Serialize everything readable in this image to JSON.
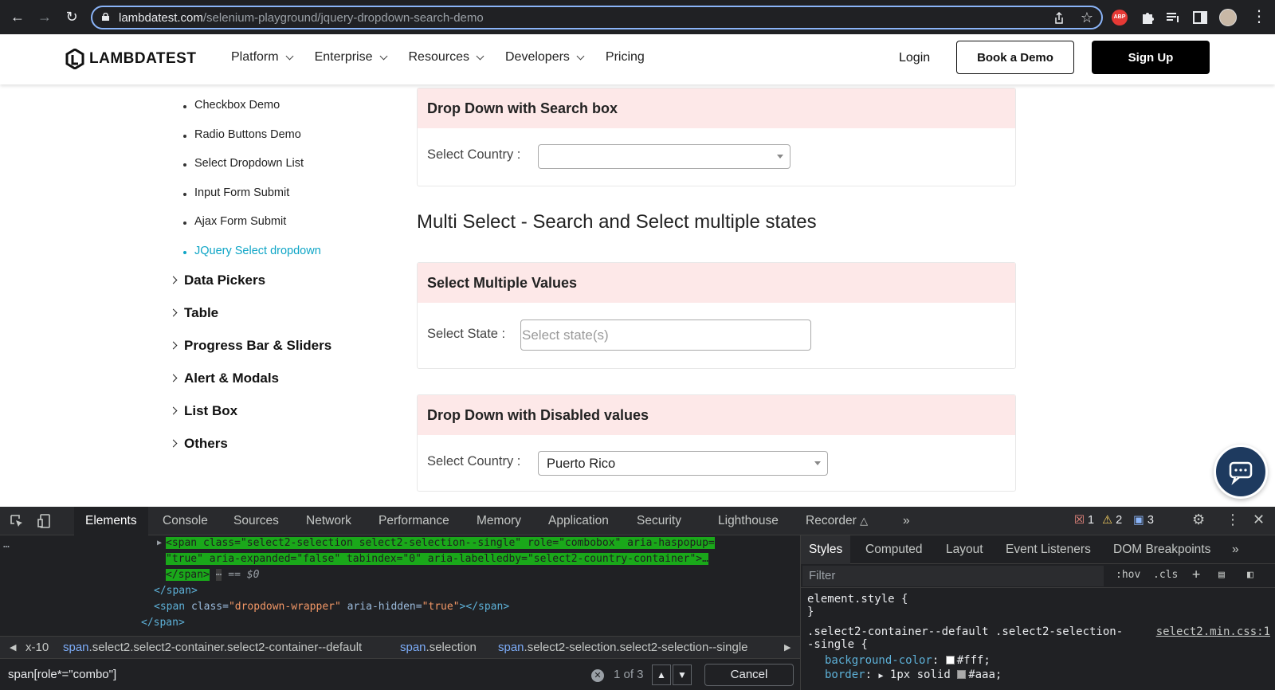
{
  "browser": {
    "url_host": "lambdatest.com",
    "url_path": "/selenium-playground/jquery-dropdown-search-demo",
    "ext_abp": "ABP"
  },
  "header": {
    "logo": "LAMBDATEST",
    "nav": [
      "Platform",
      "Enterprise",
      "Resources",
      "Developers",
      "Pricing"
    ],
    "login": "Login",
    "book_demo": "Book a Demo",
    "sign_up": "Sign Up"
  },
  "sidebar": {
    "sub_items": [
      "Checkbox Demo",
      "Radio Buttons Demo",
      "Select Dropdown List",
      "Input Form Submit",
      "Ajax Form Submit",
      "JQuery Select dropdown"
    ],
    "active_item": "JQuery Select dropdown",
    "categories": [
      "Data Pickers",
      "Table",
      "Progress Bar & Sliders",
      "Alert & Modals",
      "List Box",
      "Others"
    ]
  },
  "main": {
    "panel1": {
      "title": "Drop Down with Search box",
      "label": "Select Country :",
      "value": ""
    },
    "section_title": "Multi Select - Search and Select multiple states",
    "panel2": {
      "title": "Select Multiple Values",
      "label": "Select State :",
      "placeholder": "Select state(s)"
    },
    "panel3": {
      "title": "Drop Down with Disabled values",
      "label": "Select Country :",
      "value": "Puerto Rico"
    }
  },
  "devtools": {
    "tabs": [
      "Elements",
      "Console",
      "Sources",
      "Network",
      "Performance",
      "Memory",
      "Application",
      "Security",
      "Lighthouse",
      "Recorder"
    ],
    "active_tab": "Elements",
    "errors": "1",
    "warnings": "2",
    "messages": "3",
    "dom": {
      "line1": "<span class=\"select2-selection select2-selection--single\" role=\"combobox\" aria-haspopup=",
      "line2": "\"true\" aria-expanded=\"false\" tabindex=\"0\" aria-labelledby=\"select2-country-container\">…",
      "line3": "</span>",
      "line3_suffix": "== $0",
      "line4": "</span>",
      "line5_tag_open": "<span ",
      "line5_attr": "class=",
      "line5_val": "\"dropdown-wrapper\"",
      "line5_attr2": " aria-hidden=",
      "line5_val2": "\"true\"",
      "line5_tag_close": "></span>",
      "line6": "</span>"
    },
    "breadcrumbs": [
      {
        "tag": "",
        "text": "x-10"
      },
      {
        "tag": "span",
        "text": ".select2.select2-container.select2-container--default"
      },
      {
        "tag": "span",
        "text": ".selection"
      },
      {
        "tag": "span",
        "text": ".select2-selection.select2-selection--single"
      }
    ],
    "search": {
      "query": "span[role*=\"combo\"]",
      "count": "1 of 3",
      "cancel": "Cancel"
    },
    "styles": {
      "tabs": [
        "Styles",
        "Computed",
        "Layout",
        "Event Listeners",
        "DOM Breakpoints"
      ],
      "active_tab": "Styles",
      "filter_placeholder": "Filter",
      "hov": ":hov",
      "cls": ".cls",
      "element_style": "element.style {",
      "close_brace": "}",
      "rule_selector_1": ".select2-container--default .select2-selection-",
      "rule_selector_2": "-single {",
      "source": "select2.min.css:1",
      "prop1_name": "background-color",
      "prop1_value": "#fff;",
      "prop2_name": "border",
      "prop2_value": "1px solid",
      "prop2_color": "#aaa;"
    }
  }
}
